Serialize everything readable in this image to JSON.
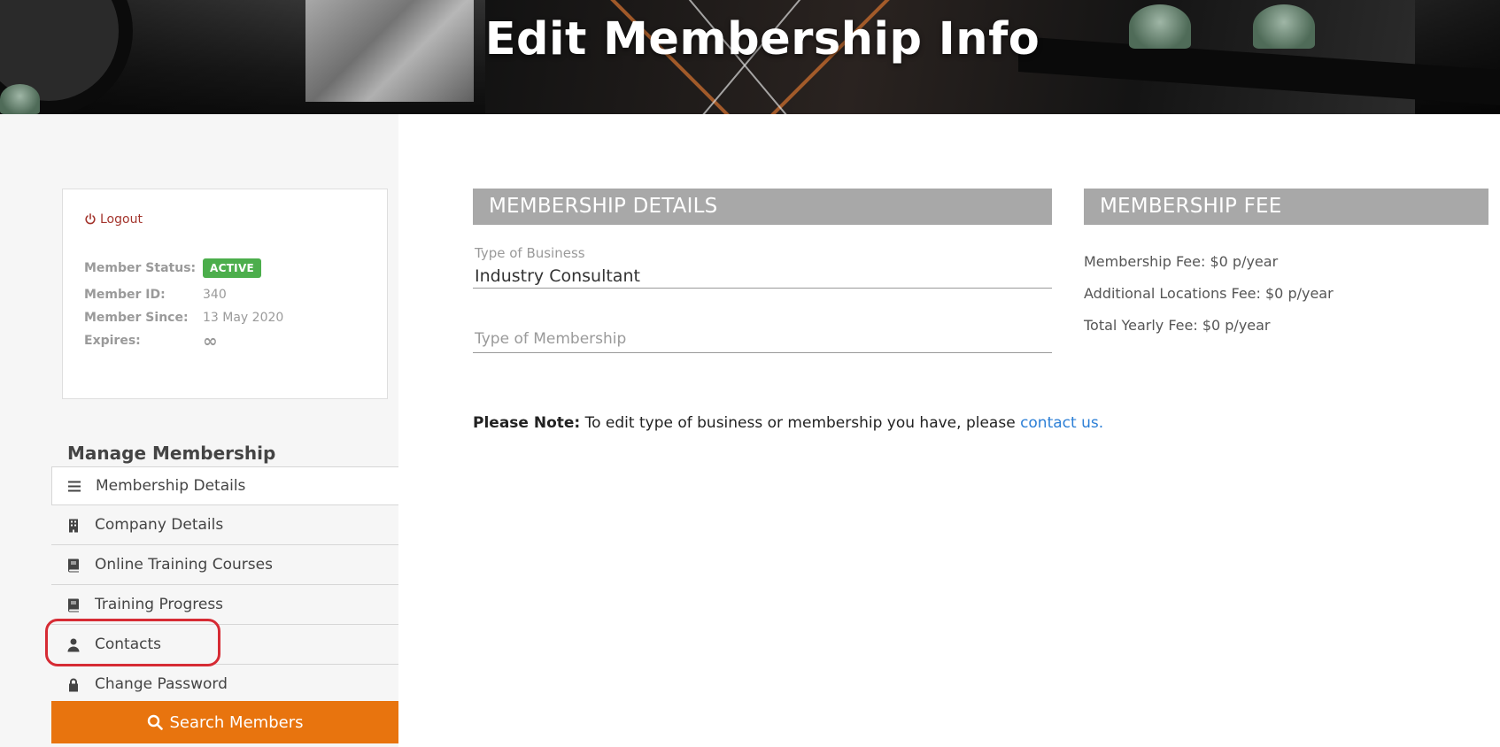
{
  "header": {
    "title": "Edit Membership Info"
  },
  "sidebar": {
    "logout_label": "Logout",
    "status": [
      {
        "label": "Member Status:",
        "value": "ACTIVE"
      },
      {
        "label": "Member ID:",
        "value": "340"
      },
      {
        "label": "Member Since:",
        "value": "13 May 2020"
      },
      {
        "label": "Expires:",
        "value": "∞"
      }
    ],
    "manage_title": "Manage Membership",
    "nav": [
      {
        "label": "Membership Details",
        "icon": "list-icon"
      },
      {
        "label": "Company Details",
        "icon": "building-icon"
      },
      {
        "label": "Online Training Courses",
        "icon": "book-icon"
      },
      {
        "label": "Training Progress",
        "icon": "book-icon"
      },
      {
        "label": "Contacts",
        "icon": "user-icon"
      },
      {
        "label": "Change Password",
        "icon": "lock-icon"
      }
    ],
    "search_label": "Search Members"
  },
  "details": {
    "heading": "MEMBERSHIP DETAILS",
    "business_label": "Type of Business",
    "business_value": "Industry Consultant",
    "membership_placeholder": "Type of Membership",
    "note_bold": "Please Note:",
    "note_text": " To edit type of business or membership you have, please ",
    "note_link": "contact us."
  },
  "fee": {
    "heading": "MEMBERSHIP FEE",
    "lines": [
      "Membership Fee: $0 p/year",
      "Additional Locations Fee: $0 p/year",
      "Total Yearly Fee: $0 p/year"
    ]
  },
  "colors": {
    "accent": "#e8740e",
    "active_badge": "#4cae4c",
    "heading_bg": "#a8a8a8",
    "link": "#2c7fd6",
    "logout": "#a3342c",
    "annotation": "#d62b34"
  }
}
